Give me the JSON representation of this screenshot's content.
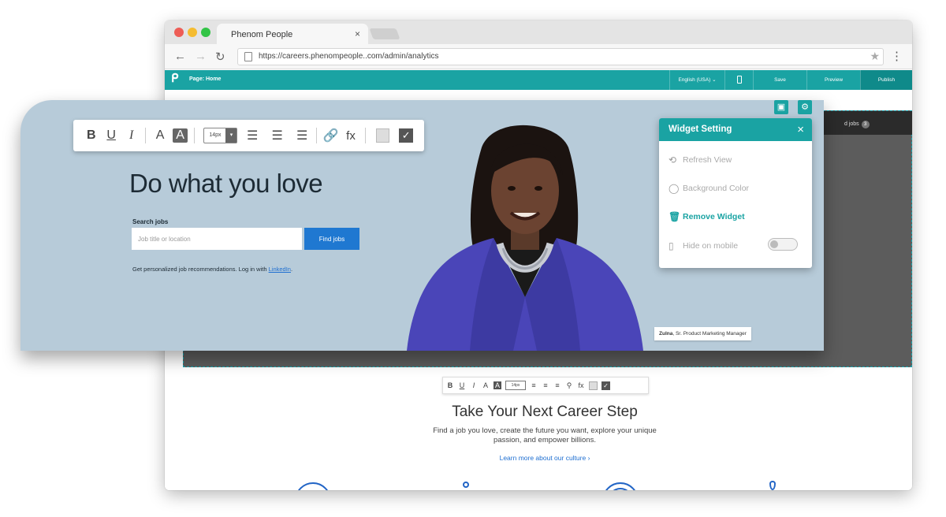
{
  "browser": {
    "tab_title": "Phenom People",
    "tab_close": "×",
    "url": "https://careers.phenompeople..com/admin/analytics"
  },
  "appbar": {
    "page_label": "Page: Home",
    "language": "English (USA) ⌄",
    "save": "Save",
    "preview": "Preview",
    "publish": "Publish"
  },
  "editor": {
    "jobs_text": "d jobs",
    "jobs_badge": "3"
  },
  "format_toolbar": {
    "bold": "B",
    "underline": "U",
    "italic": "I",
    "font_size": "14px",
    "font_size_arrow": "▾",
    "fx": "fx",
    "check": "✓"
  },
  "hero": {
    "heading": "Do what you love",
    "search_label": "Search jobs",
    "search_placeholder": "Job title or location",
    "find_button": "Find jobs",
    "personalize_text": "Get personalized job recommendations. Log in with ",
    "linkedin_link": "LinkedIn",
    "personalize_end": ".",
    "caption_name": "Zulna",
    "caption_role": ", Sr. Product Marketing Manager"
  },
  "widget": {
    "title": "Widget Setting",
    "close": "×",
    "items": [
      {
        "label": "Refresh View",
        "icon": "refresh-icon"
      },
      {
        "label": "Background Color",
        "icon": "drop-icon"
      },
      {
        "label": "Remove Widget",
        "icon": "trash-icon"
      },
      {
        "label": "Hide on mobile",
        "icon": "mobile-icon"
      }
    ]
  },
  "career": {
    "mini_font_size": "14px",
    "title": "Take Your Next Career Step",
    "description": "Find a job you love, create the future you want, explore your unique passion, and empower billions.",
    "link": "Learn more about our culture ›"
  },
  "colors": {
    "accent": "#1aa3a3",
    "button_blue": "#1f78d1",
    "hero_bg": "#b7cbd9"
  }
}
